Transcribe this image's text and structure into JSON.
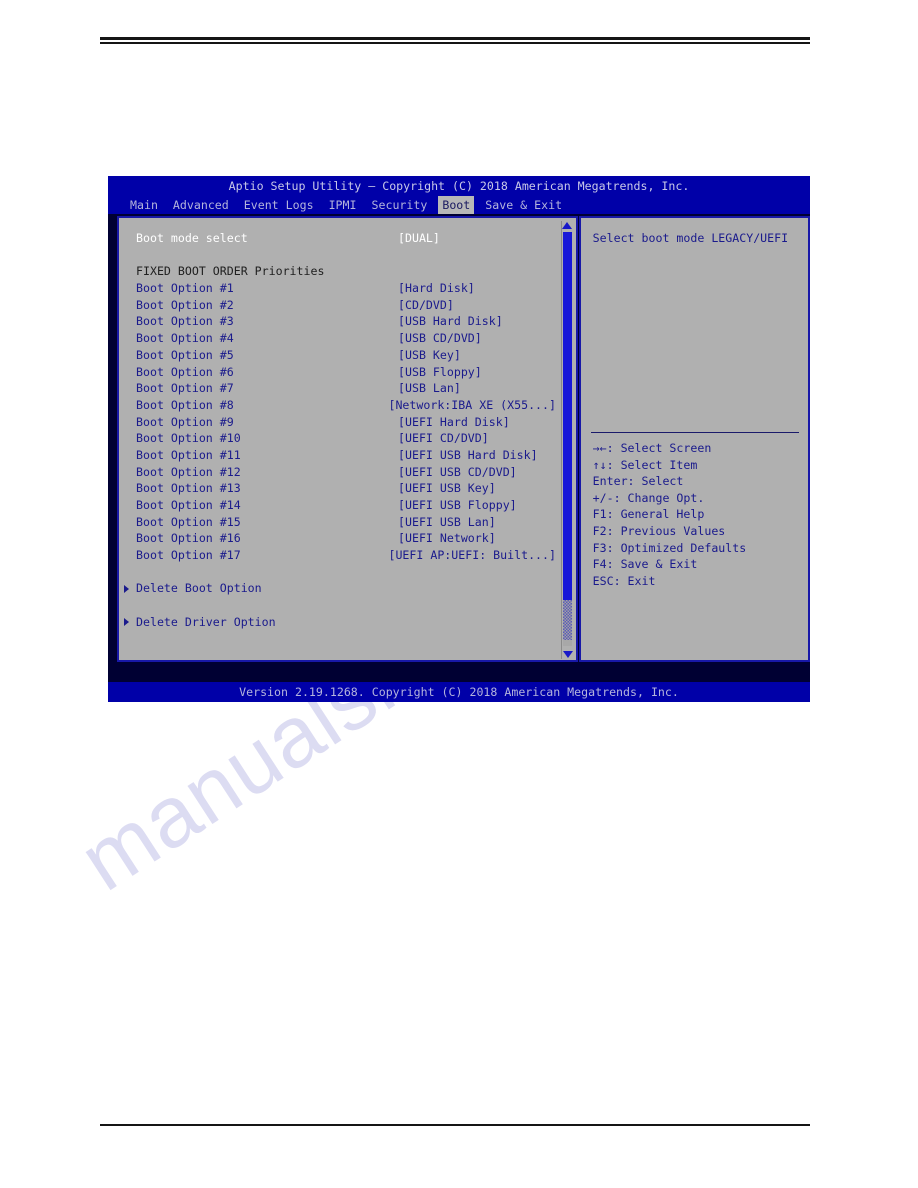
{
  "page": {
    "watermark": "manualslive.com"
  },
  "bios": {
    "title": "Aptio Setup Utility – Copyright (C) 2018 American Megatrends, Inc.",
    "footer": "Version 2.19.1268. Copyright (C) 2018 American Megatrends, Inc.",
    "menu_tabs": [
      {
        "label": "Main",
        "active": false
      },
      {
        "label": "Advanced",
        "active": false
      },
      {
        "label": "Event Logs",
        "active": false
      },
      {
        "label": "IPMI",
        "active": false
      },
      {
        "label": "Security",
        "active": false
      },
      {
        "label": "Boot",
        "active": true
      },
      {
        "label": "Save & Exit",
        "active": false
      }
    ],
    "boot_mode": {
      "label": "Boot mode select",
      "value": "[DUAL]",
      "selected": true
    },
    "section_title": "FIXED BOOT ORDER Priorities",
    "boot_options": [
      {
        "label": "Boot Option #1",
        "value": "[Hard Disk]"
      },
      {
        "label": "Boot Option #2",
        "value": "[CD/DVD]"
      },
      {
        "label": "Boot Option #3",
        "value": "[USB Hard Disk]"
      },
      {
        "label": "Boot Option #4",
        "value": "[USB CD/DVD]"
      },
      {
        "label": "Boot Option #5",
        "value": "[USB Key]"
      },
      {
        "label": "Boot Option #6",
        "value": "[USB Floppy]"
      },
      {
        "label": "Boot Option #7",
        "value": "[USB Lan]"
      },
      {
        "label": "Boot Option #8",
        "value": "[Network:IBA XE (X55...]"
      },
      {
        "label": "Boot Option #9",
        "value": "[UEFI Hard Disk]"
      },
      {
        "label": "Boot Option #10",
        "value": "[UEFI CD/DVD]"
      },
      {
        "label": "Boot Option #11",
        "value": "[UEFI USB Hard Disk]"
      },
      {
        "label": "Boot Option #12",
        "value": "[UEFI USB CD/DVD]"
      },
      {
        "label": "Boot Option #13",
        "value": "[UEFI USB Key]"
      },
      {
        "label": "Boot Option #14",
        "value": "[UEFI USB Floppy]"
      },
      {
        "label": "Boot Option #15",
        "value": "[UEFI USB Lan]"
      },
      {
        "label": "Boot Option #16",
        "value": "[UEFI Network]"
      },
      {
        "label": "Boot Option #17",
        "value": "[UEFI AP:UEFI: Built...]"
      }
    ],
    "submenus": [
      {
        "label": "Delete Boot Option"
      },
      {
        "label": "Delete Driver Option"
      }
    ],
    "help": {
      "text": "Select boot mode LEGACY/UEFI"
    },
    "legend": [
      "→←: Select Screen",
      "↑↓: Select Item",
      "Enter: Select",
      "+/-: Change Opt.",
      "F1: General Help",
      "F2: Previous Values",
      "F3: Optimized Defaults",
      "F4: Save & Exit",
      "ESC: Exit"
    ]
  }
}
